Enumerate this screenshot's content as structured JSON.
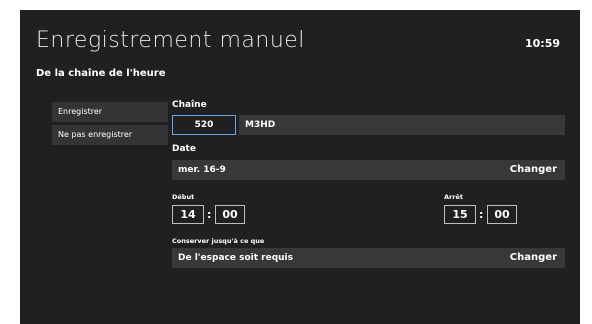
{
  "header": {
    "title": "Enregistrement manuel",
    "time": "10:59",
    "subtitle": "De la chaîne de l'heure"
  },
  "sidebar": {
    "items": [
      {
        "label": "Enregistrer"
      },
      {
        "label": "Ne pas enregistrer"
      }
    ]
  },
  "channel": {
    "label": "Chaîne",
    "number": "520",
    "name": "M3HD"
  },
  "date": {
    "label": "Date",
    "value": "mer. 16-9",
    "action": "Changer"
  },
  "start": {
    "label": "Début",
    "hour": "14",
    "minute": "00"
  },
  "end": {
    "label": "Arrêt",
    "hour": "15",
    "minute": "00"
  },
  "keep": {
    "label": "Conserver jusqu'à ce que",
    "value": "De l'espace soit requis",
    "action": "Changer"
  },
  "separator": ":"
}
